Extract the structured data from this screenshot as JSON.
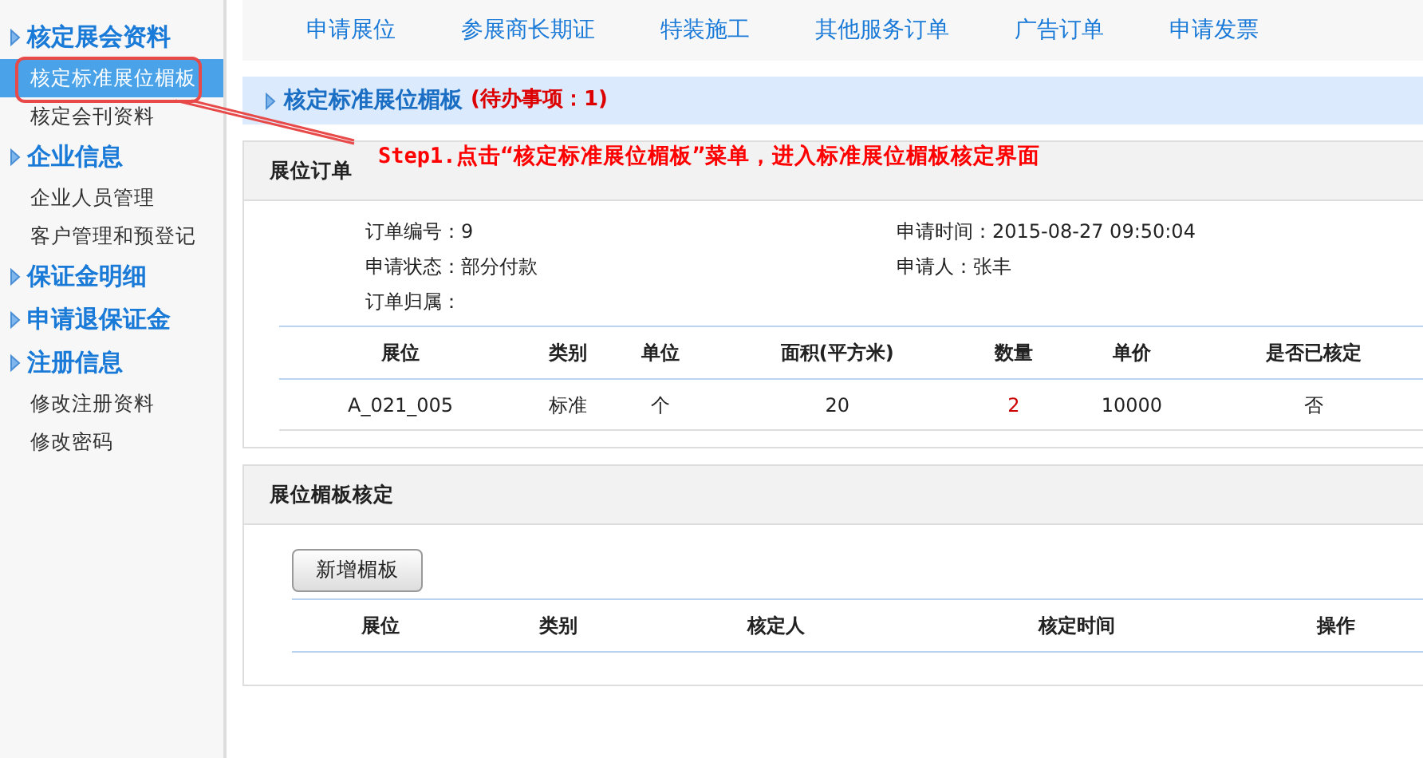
{
  "sidebar": {
    "groups": [
      {
        "title": "核定展会资料",
        "children": [
          {
            "label": "核定标准展位楣板",
            "selected": true
          },
          {
            "label": "核定会刊资料",
            "selected": false
          }
        ]
      },
      {
        "title": "企业信息",
        "children": [
          {
            "label": "企业人员管理",
            "selected": false
          },
          {
            "label": "客户管理和预登记",
            "selected": false
          }
        ]
      },
      {
        "title": "保证金明细"
      },
      {
        "title": "申请退保证金"
      },
      {
        "title": "注册信息",
        "children": [
          {
            "label": "修改注册资料",
            "selected": false
          },
          {
            "label": "修改密码",
            "selected": false
          }
        ]
      }
    ]
  },
  "top_nav": {
    "items": [
      "申请展位",
      "参展商长期证",
      "特装施工",
      "其他服务订单",
      "广告订单",
      "申请发票"
    ]
  },
  "page_title": {
    "text": "核定标准展位楣板",
    "todo": "(待办事项：1)"
  },
  "annotation": {
    "text": "Step1.点击“核定标准展位楣板”菜单，进入标准展位楣板核定界面"
  },
  "order_panel": {
    "title": "展位订单",
    "fields": [
      {
        "label": "订单编号：",
        "value": "9"
      },
      {
        "label": "申请时间：",
        "value": "2015-08-27 09:50:04"
      },
      {
        "label": "申请状态：",
        "value": "部分付款"
      },
      {
        "label": "申请人：",
        "value": "张丰"
      },
      {
        "label": "订单归属："
      }
    ],
    "table": {
      "columns": [
        "展位",
        "类别",
        "单位",
        "面积(平方米)",
        "数量",
        "单价",
        "是否已核定"
      ],
      "rows": [
        [
          "A_021_005",
          "标准",
          "个",
          "20",
          "2",
          "10000",
          "否"
        ]
      ]
    }
  },
  "fascia_panel": {
    "title": "展位楣板核定",
    "button": "新增楣板",
    "table": {
      "columns": [
        "展位",
        "类别",
        "核定人",
        "核定时间",
        "操作"
      ]
    }
  }
}
